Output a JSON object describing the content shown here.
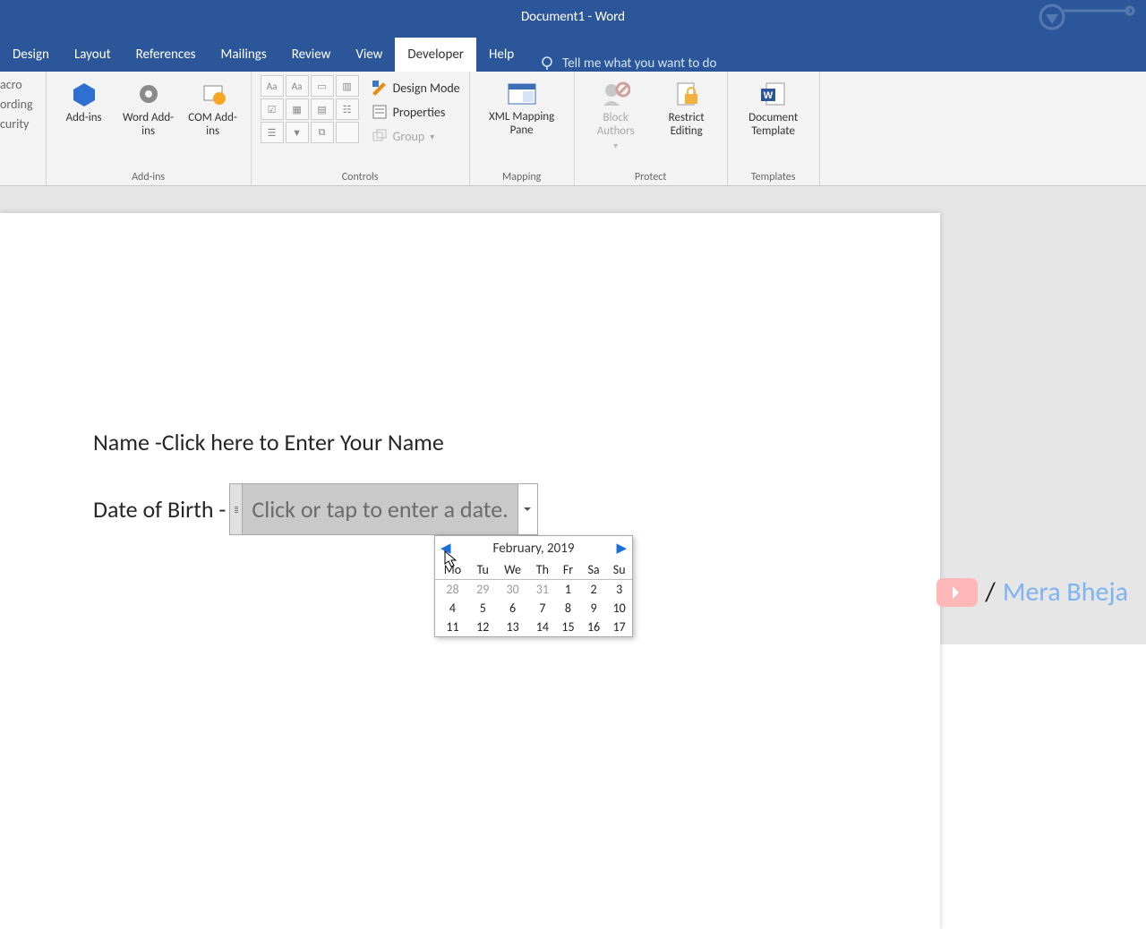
{
  "title": "Document1  -  Word",
  "tabs": [
    "Design",
    "Layout",
    "References",
    "Mailings",
    "Review",
    "View",
    "Developer",
    "Help"
  ],
  "active_tab": "Developer",
  "tellme": "Tell me what you want to do",
  "left_fragment": [
    "acro",
    "ording",
    "curity"
  ],
  "ribbon": {
    "addins": {
      "label": "Add-ins",
      "items": [
        "Add-ins",
        "Word Add-ins",
        "COM Add-ins"
      ]
    },
    "controls": {
      "label": "Controls",
      "design": "Design Mode",
      "properties": "Properties",
      "group": "Group"
    },
    "mapping": {
      "label": "Mapping",
      "item": "XML Mapping Pane"
    },
    "protect": {
      "label": "Protect",
      "block": "Block Authors",
      "restrict": "Restrict Editing"
    },
    "templates": {
      "label": "Templates",
      "item": "Document Template"
    }
  },
  "doc": {
    "name_label": "Name -",
    "name_placeholder": "Click here to Enter Your Name",
    "dob_label": "Date of Birth -",
    "dob_placeholder": "Click or tap to enter a date."
  },
  "calendar": {
    "month": "February, 2019",
    "dow": [
      "Mo",
      "Tu",
      "We",
      "Th",
      "Fr",
      "Sa",
      "Su"
    ],
    "weeks": [
      [
        {
          "d": 28,
          "o": true
        },
        {
          "d": 29,
          "o": true
        },
        {
          "d": 30,
          "o": true
        },
        {
          "d": 31,
          "o": true
        },
        {
          "d": 1
        },
        {
          "d": 2
        },
        {
          "d": 3
        }
      ],
      [
        {
          "d": 4
        },
        {
          "d": 5
        },
        {
          "d": 6
        },
        {
          "d": 7
        },
        {
          "d": 8
        },
        {
          "d": 9
        },
        {
          "d": 10
        }
      ],
      [
        {
          "d": 11
        },
        {
          "d": 12
        },
        {
          "d": 13
        },
        {
          "d": 14
        },
        {
          "d": 15
        },
        {
          "d": 16
        },
        {
          "d": 17
        }
      ]
    ]
  },
  "channel": {
    "name": "Mera Bheja"
  }
}
